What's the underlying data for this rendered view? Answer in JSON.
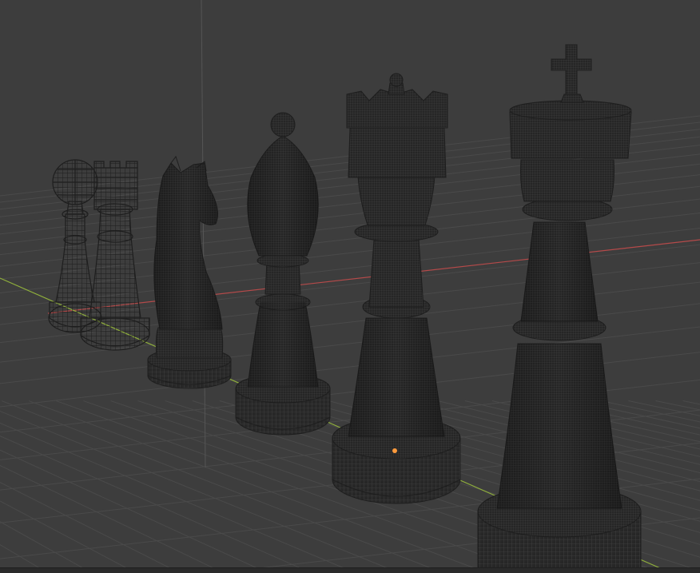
{
  "viewport": {
    "shading_mode": "wireframe",
    "background_color": "#3d3d3d",
    "grid_color": "#4a4a4a",
    "x_axis_color": "#b54a4a",
    "y_axis_color": "#8fae3c",
    "mesh_color": "#262626",
    "origin_color": "#ff9a3c"
  },
  "scene": {
    "objects": [
      {
        "name": "pawn",
        "icon": "chess-pawn"
      },
      {
        "name": "rook",
        "icon": "chess-rook"
      },
      {
        "name": "knight",
        "icon": "chess-knight"
      },
      {
        "name": "bishop",
        "icon": "chess-bishop"
      },
      {
        "name": "queen",
        "icon": "chess-queen"
      },
      {
        "name": "king",
        "icon": "chess-king"
      }
    ]
  }
}
